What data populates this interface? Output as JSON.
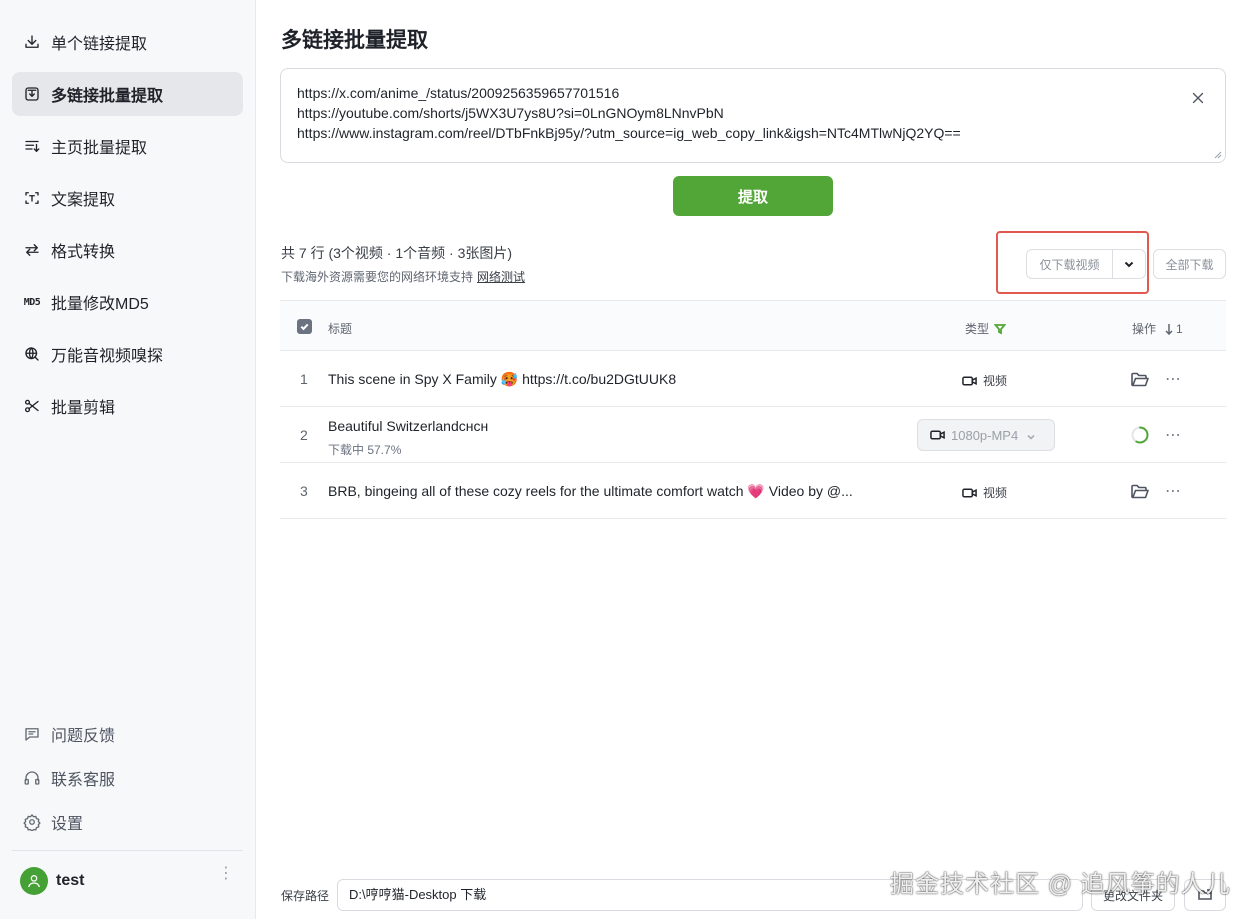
{
  "sidebar": {
    "items": [
      {
        "label": "单个链接提取",
        "icon": "download-icon"
      },
      {
        "label": "多链接批量提取",
        "icon": "batch-download-icon",
        "active": true
      },
      {
        "label": "主页批量提取",
        "icon": "list-download-icon"
      },
      {
        "label": "文案提取",
        "icon": "text-scan-icon"
      },
      {
        "label": "格式转换",
        "icon": "convert-icon"
      },
      {
        "label": "批量修改MD5",
        "icon": "md5-icon",
        "icon_text": "MD5"
      },
      {
        "label": "万能音视频嗅探",
        "icon": "sniff-icon"
      },
      {
        "label": "批量剪辑",
        "icon": "scissors-icon"
      }
    ],
    "bottom": [
      {
        "label": "问题反馈",
        "icon": "feedback-icon"
      },
      {
        "label": "联系客服",
        "icon": "headset-icon"
      },
      {
        "label": "设置",
        "icon": "gear-icon"
      }
    ],
    "user": {
      "name": "test",
      "avatar_color": "#45a035"
    }
  },
  "main": {
    "title": "多链接批量提取",
    "urls": [
      "https://x.com/anime_/status/2009256359657701516",
      "https://youtube.com/shorts/j5WX3U7ys8U?si=0LnGNOym8LNnvPbN",
      "https://www.instagram.com/reel/DTbFnkBj95y/?utm_source=ig_web_copy_link&igsh=NTc4MTlwNjQ2YQ=="
    ],
    "extract_label": "提取",
    "summary": "共 7 行 (3个视频 · 1个音频 · 3张图片)",
    "network_note": "下载海外资源需要您的网络环境支持",
    "network_link": "网络测试",
    "download_video_label": "仅下载视频",
    "download_all_label": "全部下载",
    "accent_color": "#52a637",
    "highlight_color": "#e05a4f"
  },
  "table": {
    "headers": {
      "title": "标题",
      "type": "类型",
      "ops": "操作",
      "sort": "1"
    },
    "rows": [
      {
        "index": "1",
        "title": "This scene in Spy X Family",
        "emoji": "🥵",
        "title_suffix": "https://t.co/bu2DGtUUK8",
        "type": "视频"
      },
      {
        "index": "2",
        "title": "Beautiful Switzerlandснсн",
        "status": "下载中 57.7%",
        "format": "1080p-MP4",
        "progress": 0.577
      },
      {
        "index": "3",
        "title": "BRB, bingeing all of these cozy reels for the ultimate comfort watch",
        "emoji": "💗",
        "title_suffix": "Video by @...",
        "type": "视频"
      }
    ]
  },
  "footer": {
    "path_label": "保存路径",
    "path_value": "D:\\哼哼猫-Desktop 下载",
    "change_label": "更改文件夹"
  },
  "watermark": "掘金技术社区 @ 追风筝的人儿"
}
